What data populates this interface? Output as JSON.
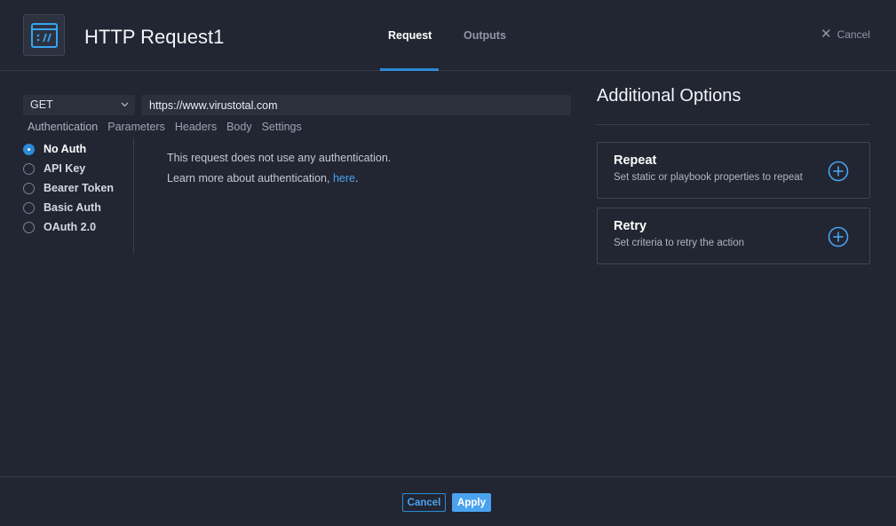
{
  "header": {
    "title": "HTTP Request1",
    "icon": "http-request-icon",
    "tabs": [
      {
        "label": "Request",
        "active": true
      },
      {
        "label": "Outputs",
        "active": false
      }
    ],
    "cancel_label": "Cancel"
  },
  "request": {
    "method": "GET",
    "url": "https://www.virustotal.com",
    "subtabs": [
      "Authentication",
      "Parameters",
      "Headers",
      "Body",
      "Settings"
    ],
    "auth_options": [
      {
        "label": "No Auth",
        "selected": true
      },
      {
        "label": "API Key",
        "selected": false
      },
      {
        "label": "Bearer Token",
        "selected": false
      },
      {
        "label": "Basic Auth",
        "selected": false
      },
      {
        "label": "OAuth 2.0",
        "selected": false
      }
    ],
    "auth_description": "This request does not use any authentication.",
    "learn_more_text": "Learn more about authentication, ",
    "learn_more_link": "here",
    "learn_more_suffix": "."
  },
  "additional_options": {
    "title": "Additional Options",
    "cards": [
      {
        "name": "Repeat",
        "description": "Set static or playbook properties to repeat",
        "icon": "plus-circle-icon"
      },
      {
        "name": "Retry",
        "description": "Set criteria to retry the action",
        "icon": "plus-circle-icon"
      }
    ]
  },
  "footer": {
    "cancel_label": "Cancel",
    "apply_label": "Apply"
  },
  "colors": {
    "background": "#222632",
    "accent": "#2c8ad8",
    "link": "#4aa3ef"
  }
}
